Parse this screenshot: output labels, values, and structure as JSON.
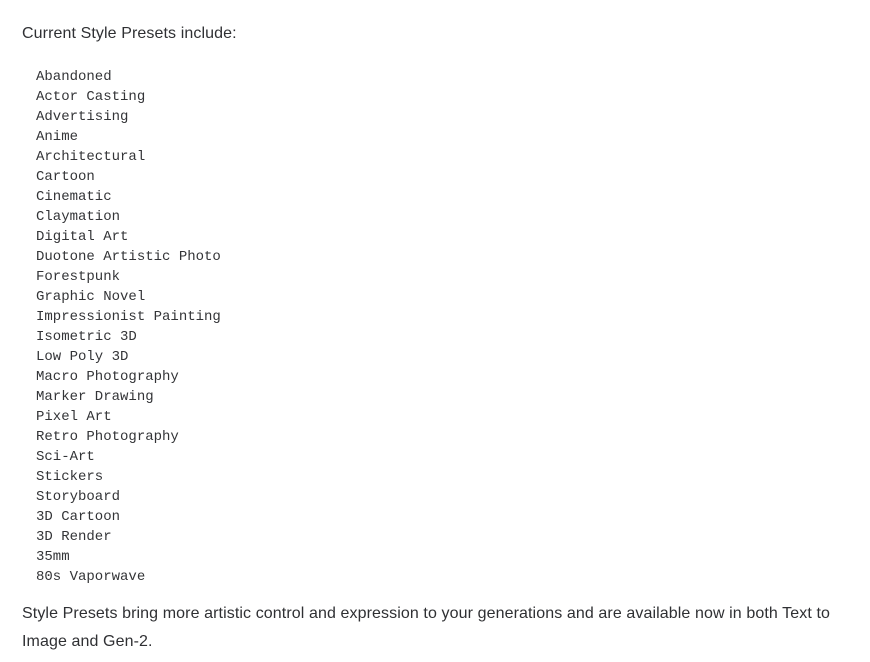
{
  "document": {
    "intro_heading": "Current Style Presets include:",
    "style_presets": [
      "Abandoned",
      "Actor Casting",
      "Advertising",
      "Anime",
      "Architectural",
      "Cartoon",
      "Cinematic",
      "Claymation",
      "Digital Art",
      "Duotone Artistic Photo",
      "Forestpunk",
      "Graphic Novel",
      "Impressionist Painting",
      "Isometric 3D",
      "Low Poly 3D",
      "Macro Photography",
      "Marker Drawing",
      "Pixel Art",
      "Retro Photography",
      "Sci-Art",
      "Stickers",
      "Storyboard",
      "3D Cartoon",
      "3D Render",
      "35mm",
      "80s Vaporwave"
    ],
    "outro_paragraph": "Style Presets bring more artistic control and expression to your generations and are available now in both Text to Image and Gen-2.",
    "colors": {
      "background": "#ffffff",
      "body_text": "#2f3033",
      "mono_text": "#333437"
    }
  }
}
